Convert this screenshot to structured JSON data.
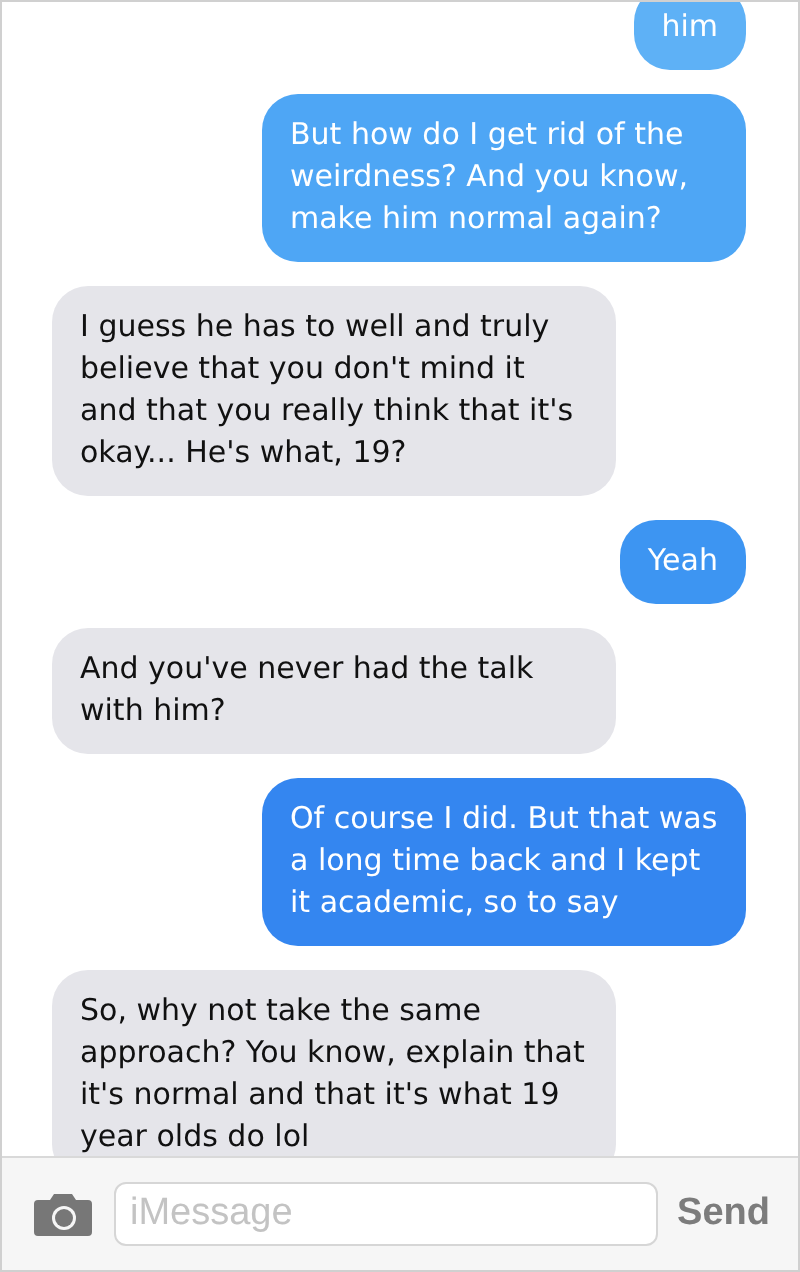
{
  "messages": [
    {
      "kind": "sent",
      "text": "him"
    },
    {
      "kind": "sent",
      "text": "But how do I get rid of the weirdness? And you know, make him normal again?"
    },
    {
      "kind": "received",
      "text": "I guess he has to well and truly believe that you don't mind it and that you really think that it's okay... He's what, 19?"
    },
    {
      "kind": "sent",
      "text": "Yeah"
    },
    {
      "kind": "received",
      "text": "And you've never had the talk with him?"
    },
    {
      "kind": "sent",
      "text": "Of course I did. But that was a long time back and I kept it academic, so to say"
    },
    {
      "kind": "received",
      "text": "So, why not take the same approach? You know, explain that it's normal and that it's what 19 year olds do lol"
    }
  ],
  "composer": {
    "placeholder": "iMessage",
    "send": "Send"
  }
}
